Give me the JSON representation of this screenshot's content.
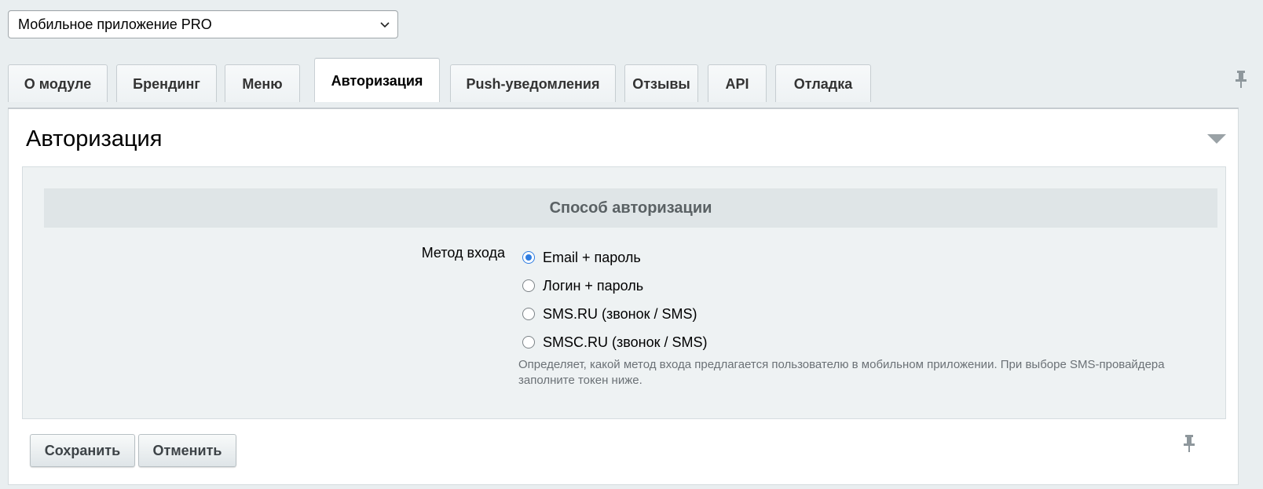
{
  "module_select": {
    "value": "Мобильное приложение PRO",
    "icon": "chevron-down-icon"
  },
  "tabs": [
    {
      "label": "О модуле",
      "active": false
    },
    {
      "label": "Брендинг",
      "active": false
    },
    {
      "label": "Меню",
      "active": false
    },
    {
      "label": "Авторизация",
      "active": true
    },
    {
      "label": "Push-уведомления",
      "active": false
    },
    {
      "label": "Отзывы",
      "active": false
    },
    {
      "label": "API",
      "active": false
    },
    {
      "label": "Отладка",
      "active": false
    }
  ],
  "panel": {
    "title": "Авторизация",
    "section_heading": "Способ авторизации",
    "field_label": "Метод входа",
    "options": [
      {
        "label": "Email + пароль",
        "checked": true
      },
      {
        "label": "Логин + пароль",
        "checked": false
      },
      {
        "label": "SMS.RU (звонок / SMS)",
        "checked": false
      },
      {
        "label": "SMSC.RU (звонок / SMS)",
        "checked": false
      }
    ],
    "hint": "Определяет, какой метод входа предлагается пользователю в мобильном приложении. При выборе SMS-провайдера заполните токен ниже."
  },
  "buttons": {
    "save": "Сохранить",
    "cancel": "Отменить"
  },
  "colors": {
    "accent": "#2f7de1",
    "page_bg": "#e9eef0",
    "section_bg": "#eef2f3"
  }
}
